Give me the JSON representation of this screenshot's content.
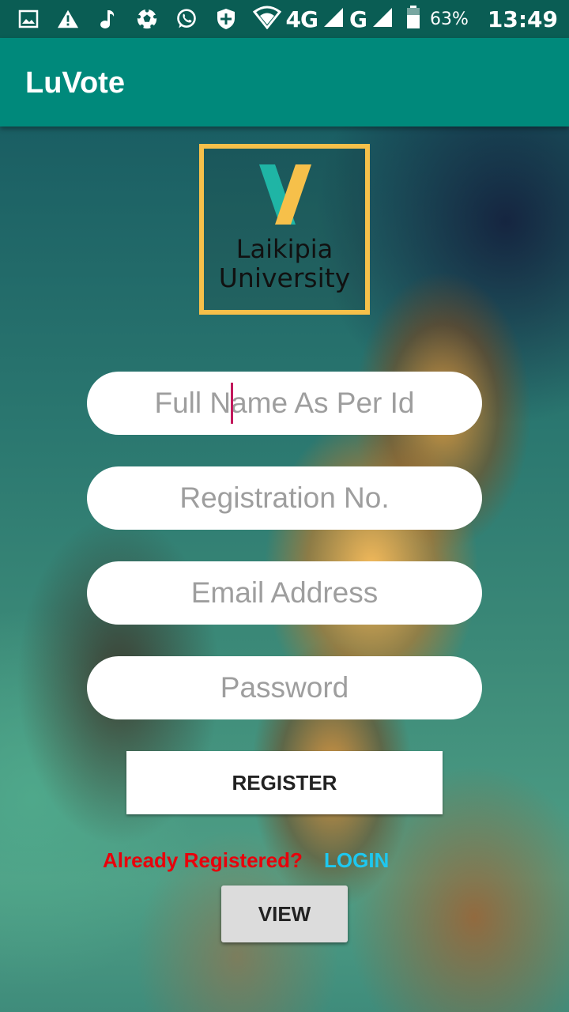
{
  "status_bar": {
    "icons_left": [
      "image-icon",
      "warning-icon",
      "music-note-icon",
      "soccer-ball-icon",
      "whatsapp-icon",
      "shield-plus-icon"
    ],
    "network_1": "4G",
    "network_2": "G",
    "battery_percent": "63%",
    "time": "13:49"
  },
  "app_bar": {
    "title": "LuVote"
  },
  "logo": {
    "line1": "Laikipia",
    "line2": "University",
    "colors": {
      "frame": "#f6c04a",
      "x_teal": "#1fb5a5",
      "x_yellow": "#f6c04a"
    }
  },
  "form": {
    "full_name": {
      "placeholder": "Full Name As Per Id",
      "value": ""
    },
    "reg_no": {
      "placeholder": "Registration No.",
      "value": ""
    },
    "email": {
      "placeholder": "Email Address",
      "value": ""
    },
    "password": {
      "placeholder": "Password",
      "value": ""
    }
  },
  "buttons": {
    "register": "REGISTER",
    "view": "VIEW"
  },
  "login_prompt": {
    "question": "Already Registered?",
    "link": "LOGIN"
  },
  "colors": {
    "status_bar": "#0a5d54",
    "app_bar": "#00897b",
    "question": "#e8000b",
    "login_link": "#1ec8f0",
    "caret": "#c2185b"
  }
}
